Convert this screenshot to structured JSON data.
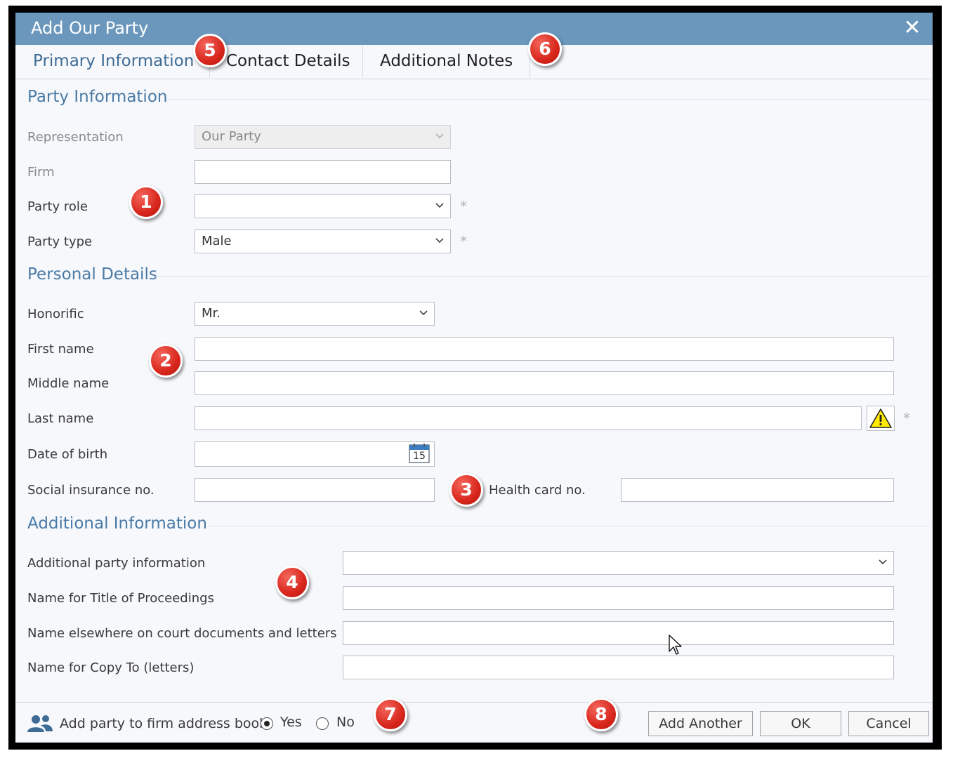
{
  "window": {
    "title": "Add Our Party",
    "close_glyph": "✕"
  },
  "tabs": [
    {
      "label": "Primary Information",
      "active": true
    },
    {
      "label": "Contact Details",
      "active": false
    },
    {
      "label": "Additional Notes",
      "active": false
    }
  ],
  "sections": {
    "party_info": {
      "title": "Party Information",
      "representation": {
        "label": "Representation",
        "value": "Our Party"
      },
      "firm": {
        "label": "Firm",
        "value": ""
      },
      "party_role": {
        "label": "Party role",
        "value": "",
        "required_mark": "*"
      },
      "party_type": {
        "label": "Party type",
        "value": "Male",
        "required_mark": "*"
      }
    },
    "personal": {
      "title": "Personal Details",
      "honorific": {
        "label": "Honorific",
        "value": "Mr."
      },
      "first_name": {
        "label": "First name",
        "value": ""
      },
      "middle_name": {
        "label": "Middle name",
        "value": ""
      },
      "last_name": {
        "label": "Last name",
        "value": "",
        "required_mark": "*"
      },
      "dob": {
        "label": "Date of birth",
        "value": "",
        "calendar_day": "15"
      },
      "sin": {
        "label": "Social insurance no.",
        "value": ""
      },
      "health_card": {
        "label": "Health card no.",
        "value": ""
      }
    },
    "additional": {
      "title": "Additional Information",
      "additional_party_info": {
        "label": "Additional party information",
        "value": ""
      },
      "name_title_proceedings": {
        "label": "Name for Title of Proceedings",
        "value": ""
      },
      "name_elsewhere": {
        "label": "Name elsewhere on court documents and letters",
        "value": ""
      },
      "name_copy_to": {
        "label": "Name for Copy To (letters)",
        "value": ""
      }
    }
  },
  "footer": {
    "address_book_label": "Add party to firm address book",
    "yes_label": "Yes",
    "no_label": "No",
    "selected": "Yes",
    "buttons": {
      "add_another": "Add Another",
      "ok": "OK",
      "cancel": "Cancel"
    }
  },
  "badges": [
    "1",
    "2",
    "3",
    "4",
    "5",
    "6",
    "7",
    "8"
  ],
  "colors": {
    "titlebar": "#6b97bd",
    "accent": "#4a7aa6",
    "badge": "#d8261c"
  },
  "icons": [
    "close-icon",
    "chevron-down-icon",
    "calendar-icon",
    "warning-icon",
    "people-icon",
    "mouse-cursor-icon"
  ]
}
